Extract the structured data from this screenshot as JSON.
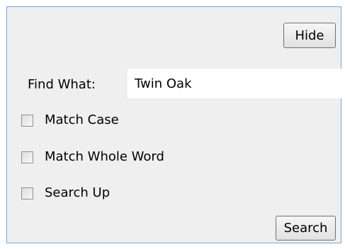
{
  "header": {
    "hide_label": "Hide"
  },
  "find": {
    "label": "Find What:",
    "value": "Twin Oak"
  },
  "options": [
    {
      "label": "Match Case",
      "checked": false
    },
    {
      "label": "Match Whole Word",
      "checked": false
    },
    {
      "label": "Search Up",
      "checked": false
    }
  ],
  "footer": {
    "search_label": "Search"
  },
  "colors": {
    "panel_background": "#efefef",
    "panel_border": "#7aa7d3",
    "input_background": "#ffffff"
  }
}
